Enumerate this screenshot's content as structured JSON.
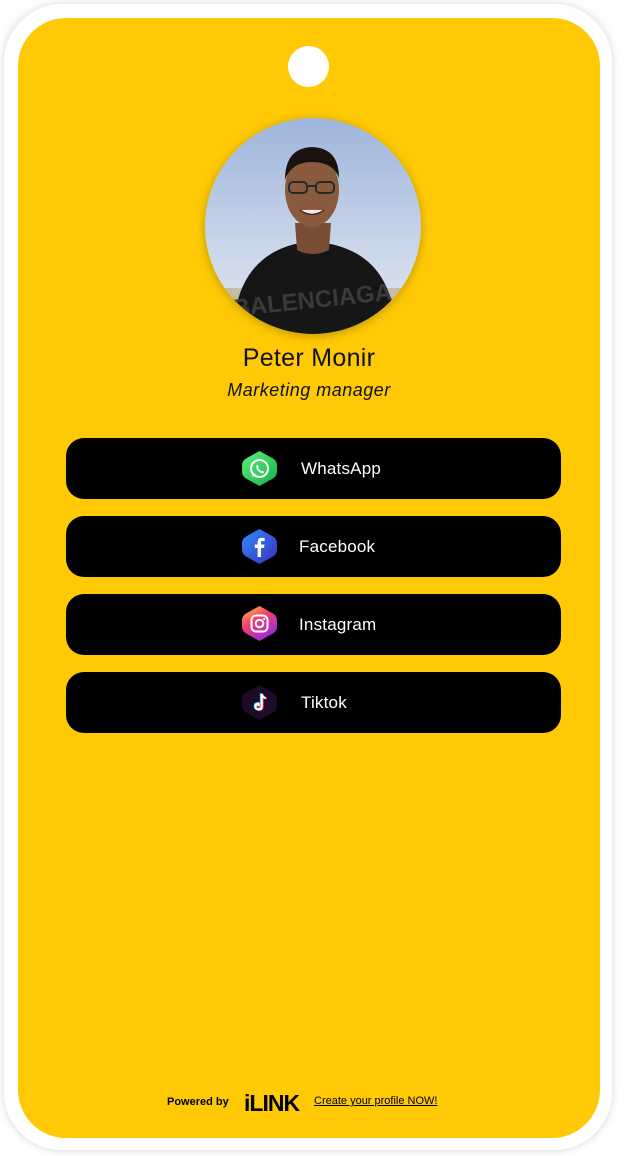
{
  "profile": {
    "name": "Peter Monir",
    "title": "Marketing  manager"
  },
  "links": [
    {
      "label": "WhatsApp",
      "icon": "whatsapp-icon"
    },
    {
      "label": "Facebook",
      "icon": "facebook-icon"
    },
    {
      "label": "Instagram",
      "icon": "instagram-icon"
    },
    {
      "label": "Tiktok",
      "icon": "tiktok-icon"
    }
  ],
  "footer": {
    "powered_by": "Powered by",
    "brand": "iLINK",
    "cta": "Create your profile NOW!"
  },
  "colors": {
    "card": "#FFCA05",
    "button": "#000000",
    "button_text": "#FFFFFF"
  }
}
